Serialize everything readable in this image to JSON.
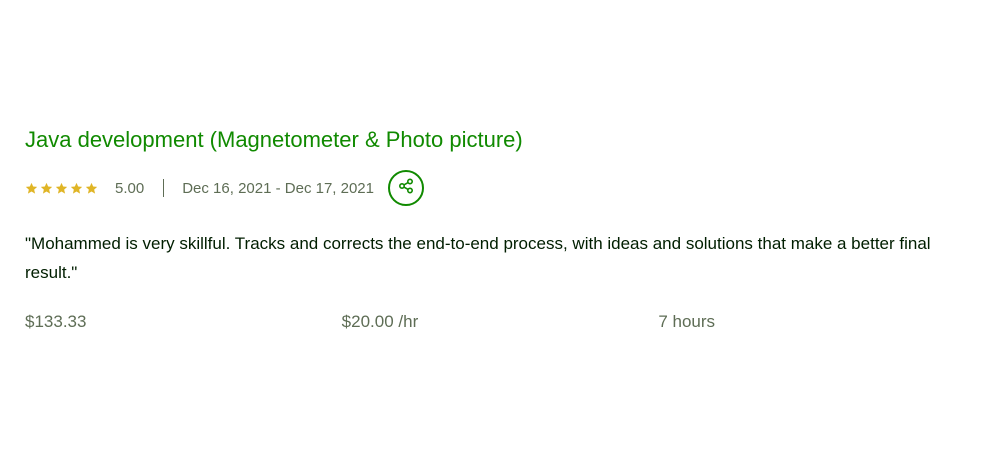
{
  "review": {
    "title": "Java development (Magnetometer & Photo picture)",
    "rating_value": "5.00",
    "stars": 5,
    "star_color": "#f1c40f",
    "dates": "Dec 16, 2021 - Dec 17, 2021",
    "share_icon": "share-icon",
    "quote": "\"Mohammed is very skillful. Tracks and corrects the end-to-end process, with ideas and solutions that make a better final result.\"",
    "total_earned": "$133.33",
    "hourly_rate": "$20.00 /hr",
    "hours": "7 hours"
  },
  "colors": {
    "accent": "#108a00",
    "muted": "#5e6d55",
    "text": "#001e00"
  }
}
